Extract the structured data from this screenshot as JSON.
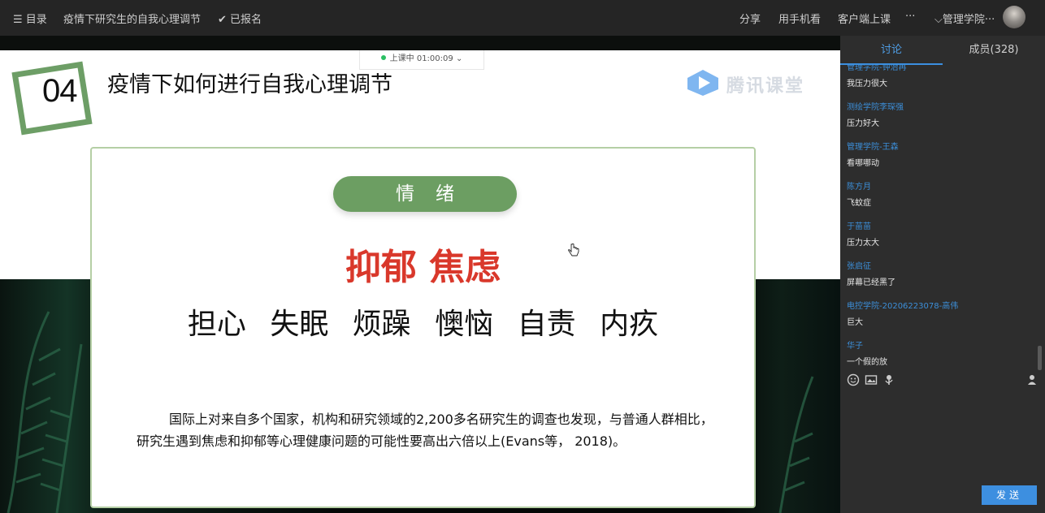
{
  "header": {
    "menu_label": "目录",
    "course_title": "疫情下研究生的自我心理调节",
    "enrolled_label": "已报名",
    "share": "分享",
    "mobile_watch": "用手机看",
    "client_class": "客户端上课",
    "more": "···",
    "user_name": "管理学院···"
  },
  "stage": {
    "live_status": "上课中 01:00:09",
    "slide": {
      "section_number": "04",
      "title": "疫情下如何进行自我心理调节",
      "logo_text": "腾讯课堂",
      "pill_label": "情绪",
      "red_words": "抑郁 焦虑",
      "black_words": "担心 失眠 烦躁 懊恼 自责 内疚",
      "paragraph": "国际上对来自多个国家，机构和研究领域的2,200多名研究生的调查也发现，与普通人群相比，研究生遇到焦虑和抑郁等心理健康问题的可能性要高出六倍以上(Evans等， 2018)。"
    }
  },
  "sidebar": {
    "tabs": {
      "discuss": "讨论",
      "members": "成员(328)"
    },
    "messages": [
      {
        "name": "管理学院-钟治再",
        "text": "我压力很大"
      },
      {
        "name": "测绘学院李琛强",
        "text": "压力好大"
      },
      {
        "name": "管理学院-王森",
        "text": "看哪哪动"
      },
      {
        "name": "陈方月",
        "text": "飞蚊症"
      },
      {
        "name": "于苗苗",
        "text": "压力太大"
      },
      {
        "name": "张启征",
        "text": "屏幕已经黑了"
      },
      {
        "name": "电控学院-20206223078-高伟",
        "text": "巨大"
      },
      {
        "name": "华子",
        "text": "一个假的放"
      }
    ],
    "send_label": "发送"
  },
  "colors": {
    "accent": "#3d8fe0",
    "slide_green": "#6c9e62",
    "highlight_red": "#d9382b"
  }
}
